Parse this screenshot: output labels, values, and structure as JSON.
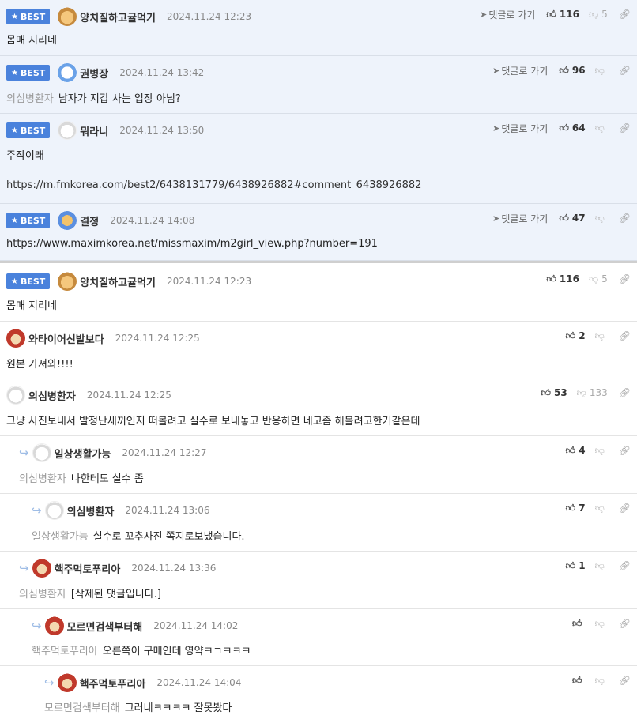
{
  "labels": {
    "best": "BEST",
    "goto": "댓글로 가기"
  },
  "icons": {
    "star": "star-icon",
    "goto": "arrow-icon",
    "up": "thumbs-up-icon",
    "down": "thumbs-down-icon",
    "link": "link-icon",
    "reply": "reply-arrow-icon"
  },
  "colors": {
    "best_badge": "#4a82dc",
    "best_bg": "#eef3fb"
  },
  "best": [
    {
      "nick": "양치질하고귤먹기",
      "date": "2024.11.24 12:23",
      "up": "116",
      "down": "5",
      "body": "몸매 지리네",
      "target": ""
    },
    {
      "nick": "권병장",
      "date": "2024.11.24 13:42",
      "up": "96",
      "down": "",
      "body": "남자가 지갑 사는 입장 아님?",
      "target": "의심병환자"
    },
    {
      "nick": "뭐라니",
      "date": "2024.11.24 13:50",
      "up": "64",
      "down": "",
      "body": "주작이래",
      "body2": "https://m.fmkorea.com/best2/6438131779/6438926882#comment_6438926882",
      "target": ""
    },
    {
      "nick": "결정",
      "date": "2024.11.24 14:08",
      "up": "47",
      "down": "",
      "body": "https://www.maximkorea.net/missmaxim/m2girl_view.php?number=191",
      "target": ""
    }
  ],
  "comments": [
    {
      "nick": "양치질하고귤먹기",
      "date": "2024.11.24 12:23",
      "up": "116",
      "down": "5",
      "body": "몸매 지리네",
      "target": ""
    },
    {
      "nick": "와타이어신발보다",
      "date": "2024.11.24 12:25",
      "up": "2",
      "down": "",
      "body": "원본 가져와!!!!",
      "target": ""
    },
    {
      "nick": "의심병환자",
      "date": "2024.11.24 12:25",
      "up": "53",
      "down": "133",
      "body": "그냥 사진보내서 발정난새끼인지 떠볼려고 실수로 보내놓고 반응하면 네고좀 해볼려고한거같은데",
      "target": ""
    },
    {
      "nick": "일상생활가능",
      "date": "2024.11.24 12:27",
      "up": "4",
      "down": "",
      "body": "나한테도 실수 좀",
      "target": "의심병환자"
    },
    {
      "nick": "의심병환자",
      "date": "2024.11.24 13:06",
      "up": "7",
      "down": "",
      "body": "실수로 꼬추사진 쪽지로보냈습니다.",
      "target": "일상생활가능"
    },
    {
      "nick": "핵주먹토푸리아",
      "date": "2024.11.24 13:36",
      "up": "1",
      "down": "",
      "body": "[삭제된 댓글입니다.]",
      "target": "의심병환자"
    },
    {
      "nick": "모르면검색부터해",
      "date": "2024.11.24 14:02",
      "up": "",
      "down": "",
      "body": "오른쪽이 구매인데 영약ㅋㄱㅋㅋㅋ",
      "target": "핵주먹토푸리아"
    },
    {
      "nick": "핵주먹토푸리아",
      "date": "2024.11.24 14:04",
      "up": "",
      "down": "",
      "body": "그러네ㅋㅋㅋㅋ 잘못봤다",
      "target": "모르면검색부터해"
    }
  ]
}
